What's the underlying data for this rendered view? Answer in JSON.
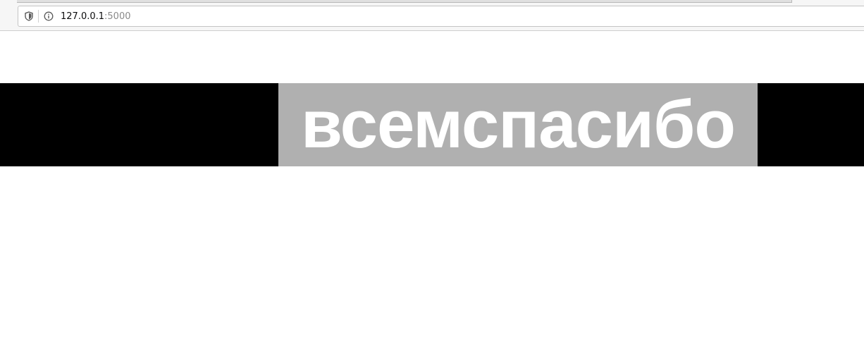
{
  "browser": {
    "url_host": "127.0.0.1",
    "url_port": ":5000",
    "icons": {
      "tracking": "shield-icon",
      "site_info": "info-icon"
    }
  },
  "page": {
    "banner_text": "всемспасибо",
    "colors": {
      "banner_background": "#000000",
      "text_highlight": "#b0b0b0",
      "text_color": "#ffffff"
    }
  }
}
